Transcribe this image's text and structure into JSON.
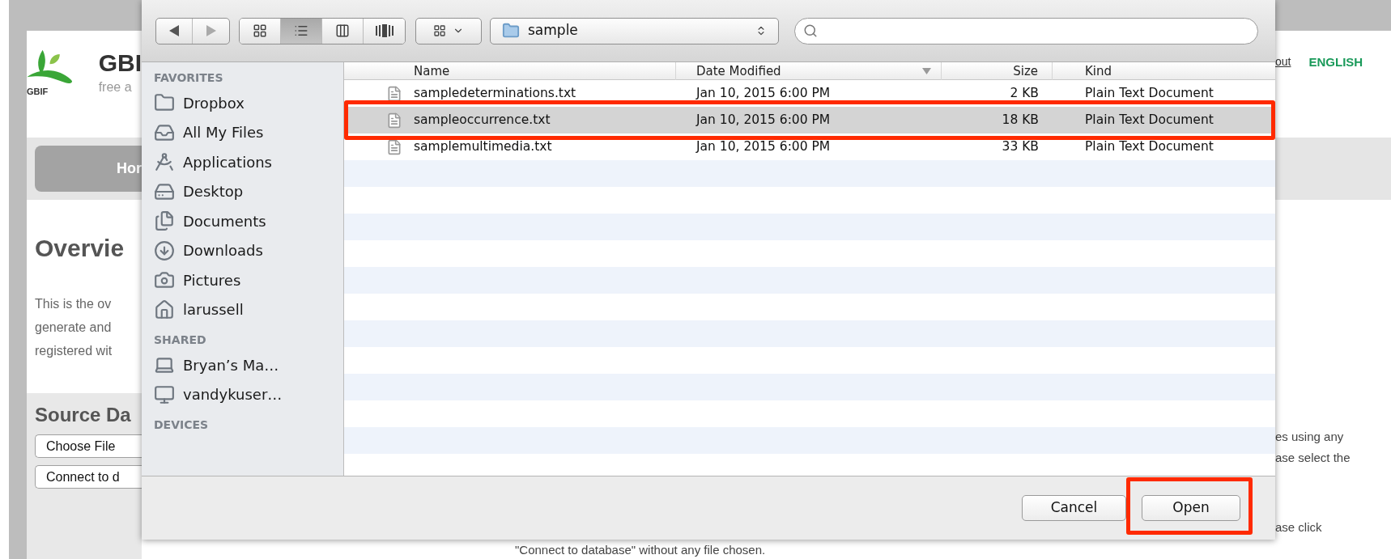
{
  "background_page": {
    "logo_text": "GBIF",
    "site_title": "GBI",
    "tagline": "free a",
    "nav": [
      {
        "label": "Hor"
      }
    ],
    "heading": "Overvie",
    "intro_lines": [
      "This is the ov",
      "generate and",
      "registered wit"
    ],
    "source": {
      "heading": "Source Da",
      "buttons": [
        "Choose File",
        "Connect to d"
      ]
    },
    "header_links": [
      {
        "label": "out",
        "kind": "link"
      },
      {
        "label": "ENGLISH",
        "kind": "language"
      }
    ],
    "right_fragments": [
      "es using any",
      "ase select the",
      "ase click"
    ],
    "bottom_line": "\"Connect to database\" without any file chosen."
  },
  "dialog": {
    "view_modes": [
      {
        "selected": false
      },
      {
        "selected": true
      },
      {
        "selected": false
      },
      {
        "selected": false
      }
    ],
    "location": "sample",
    "sidebar": [
      {
        "heading": "FAVORITES",
        "items": [
          "Dropbox",
          "All My Files",
          "Applications",
          "Desktop",
          "Documents",
          "Downloads",
          "Pictures",
          "larussell"
        ]
      },
      {
        "heading": "SHARED",
        "items": [
          "Bryan’s Ma…",
          "vandykuser…"
        ]
      },
      {
        "heading": "DEVICES"
      }
    ],
    "columns": [
      {
        "label": "Name",
        "sorted": false
      },
      {
        "label": "Date Modified",
        "sorted": true
      },
      {
        "label": "Size",
        "sorted": false
      },
      {
        "label": "Kind",
        "sorted": false
      }
    ],
    "files": [
      {
        "name": "sampledeterminations.txt",
        "modified": "Jan 10, 2015 6:00 PM",
        "size": "2 KB",
        "kind": "Plain Text Document",
        "selected": false,
        "highlighted": false
      },
      {
        "name": "sampleoccurrence.txt",
        "modified": "Jan 10, 2015 6:00 PM",
        "size": "18 KB",
        "kind": "Plain Text Document",
        "selected": true,
        "highlighted": true
      },
      {
        "name": "samplemultimedia.txt",
        "modified": "Jan 10, 2015 6:00 PM",
        "size": "33 KB",
        "kind": "Plain Text Document",
        "selected": false,
        "highlighted": false
      }
    ],
    "buttons": [
      {
        "label": "Cancel",
        "highlighted": false
      },
      {
        "label": "Open",
        "highlighted": true
      }
    ]
  }
}
